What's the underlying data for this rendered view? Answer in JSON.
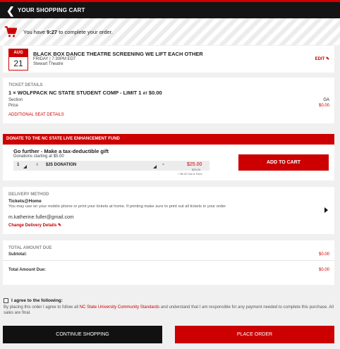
{
  "header": {
    "back_icon": "chevron-left-icon",
    "title": "YOUR SHOPPING CART"
  },
  "timer": {
    "prefix": "You have ",
    "time": "9:27",
    "suffix": " to complete your order."
  },
  "event": {
    "month": "AUG",
    "day": "21",
    "title": "BLACK BOX DANCE THEATRE SCREENING WE LIFT EACH OTHER",
    "datetime": "FRIDAY | 7:30PM EDT",
    "venue": "Stewart Theatre",
    "edit_label": "EDIT"
  },
  "tickets": {
    "heading": "TICKET DETAILS",
    "qty": "1",
    "times": "×",
    "name": "WOLFPACK NC STATE STUDENT COMP - LIMIT 1",
    "at": "AT",
    "price": "$0.00",
    "section_label": "Section",
    "section_value": "GA",
    "price_label": "Price",
    "price_value": "$0.00",
    "additional_link": "ADDITIONAL SEAT DETAILS"
  },
  "donate": {
    "heading": "DONATE TO THE NC STATE LIVE ENHANCEMENT FUND",
    "title": "Go further - Make a tax-deductible gift",
    "subtitle": "Donations starting at $5.00",
    "qty": "1",
    "times": "X",
    "option": "$25 DONATION",
    "equals": "=",
    "total": "$25.00",
    "subtotal_small": "$25.00",
    "fees_small": "+ $0.00 Tax & Fees",
    "add_button": "ADD TO CART"
  },
  "delivery": {
    "heading": "DELIVERY METHOD",
    "method": "Tickets@Home",
    "description": "You may use on your mobile phone or print your tickets at home. If printing make sure to print out all tickets in your order",
    "email": "m.katherine.fuller@gmail.com",
    "change_link": "Change Delivery Details"
  },
  "total": {
    "heading": "TOTAL AMOUNT DUE",
    "subtotal_label": "Subtotal:",
    "subtotal_value": "$0.00",
    "total_label": "Total Amount Due:",
    "total_value": "$0.00"
  },
  "agreement": {
    "label": "I agree to the following:",
    "text_before": "By placing this order I agree to follow all ",
    "link": "NC State University Community Standards",
    "text_after": " and understand that I am responsible for any payment needed to complete this purchase. All sales are final."
  },
  "actions": {
    "continue": "CONTINUE SHOPPING",
    "place": "PLACE ORDER"
  },
  "colors": {
    "accent": "#cc0000",
    "header_bg": "#141414"
  }
}
